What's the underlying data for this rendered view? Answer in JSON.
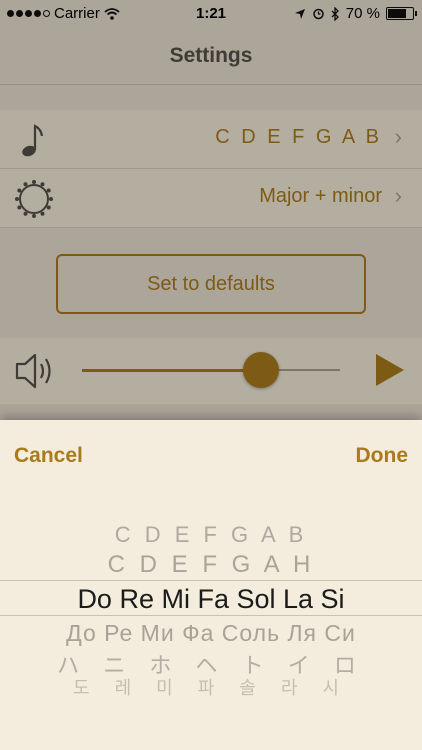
{
  "status_bar": {
    "carrier": "Carrier",
    "time": "1:21",
    "battery": "70 %"
  },
  "nav": {
    "title": "Settings"
  },
  "settings": {
    "notation_value": "C D E F G A B",
    "scale_value": "Major + minor",
    "defaults_button": "Set to defaults"
  },
  "player": {
    "volume_level": 0.69
  },
  "picker": {
    "cancel_label": "Cancel",
    "done_label": "Done",
    "options": [
      "C D E F G A B",
      "C D E F G A H",
      "Do Re Mi Fa Sol La Si",
      "До Ре Ми Фа Соль Ля Си",
      "ハ ニ ホ ヘ ト イ ロ",
      "도 레 미 파 솔 라 시"
    ],
    "selected_option": "Do Re Mi Fa Sol La Si"
  },
  "colors": {
    "accent": "#a97b1d",
    "background": "#f4ecdc",
    "secondary_text": "#a8a49c"
  }
}
